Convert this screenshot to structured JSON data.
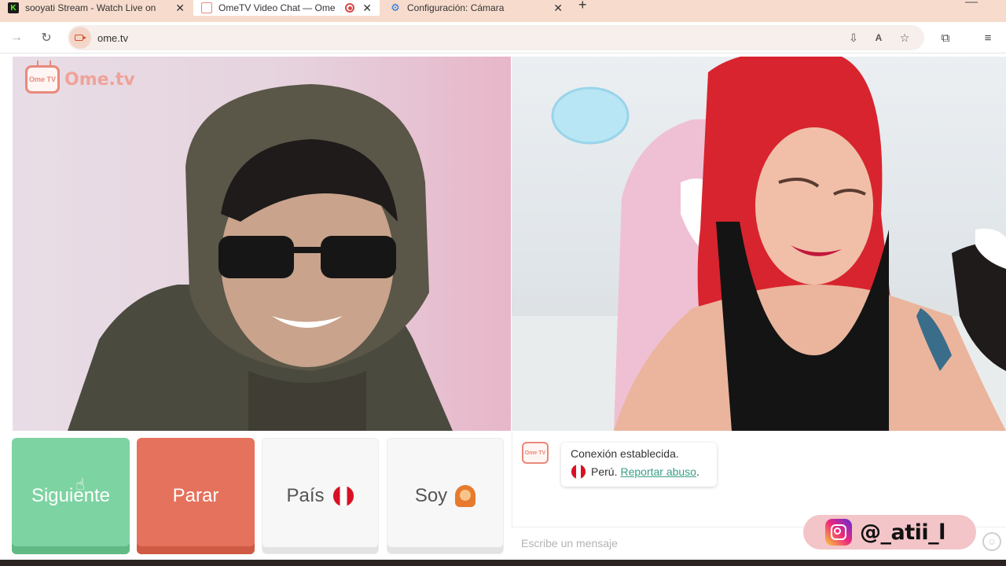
{
  "browser": {
    "tabs": [
      {
        "title": "sooyati Stream - Watch Live on",
        "icon": "kick-icon",
        "active": false
      },
      {
        "title": "OmeTV Video Chat — Ome",
        "icon": "ometv-icon",
        "active": true,
        "recording": true
      },
      {
        "title": "Configuración: Cámara",
        "icon": "settings-gear-icon",
        "active": false
      }
    ],
    "new_tab": "+",
    "minimize": "—",
    "close_glyph": "✕",
    "url": "ome.tv"
  },
  "page": {
    "logo_text": "Ome.tv",
    "logo_tv_text": "Ome TV",
    "controls": {
      "next_label": "Siguiente",
      "stop_label": "Parar",
      "country_label": "País",
      "gender_label": "Soy"
    },
    "chat": {
      "status_line": "Conexión establecida.",
      "country": "Perú.",
      "report_link": "Reportar abuso",
      "report_suffix": ".",
      "input_placeholder": "Escribe un mensaje"
    },
    "overlay": {
      "instagram_handle": "@_atii_l"
    }
  },
  "colors": {
    "next_button": "#7ed3a2",
    "stop_button": "#e5725c",
    "accent_link": "#3a9e86",
    "tab_strip": "#f7dccd"
  }
}
